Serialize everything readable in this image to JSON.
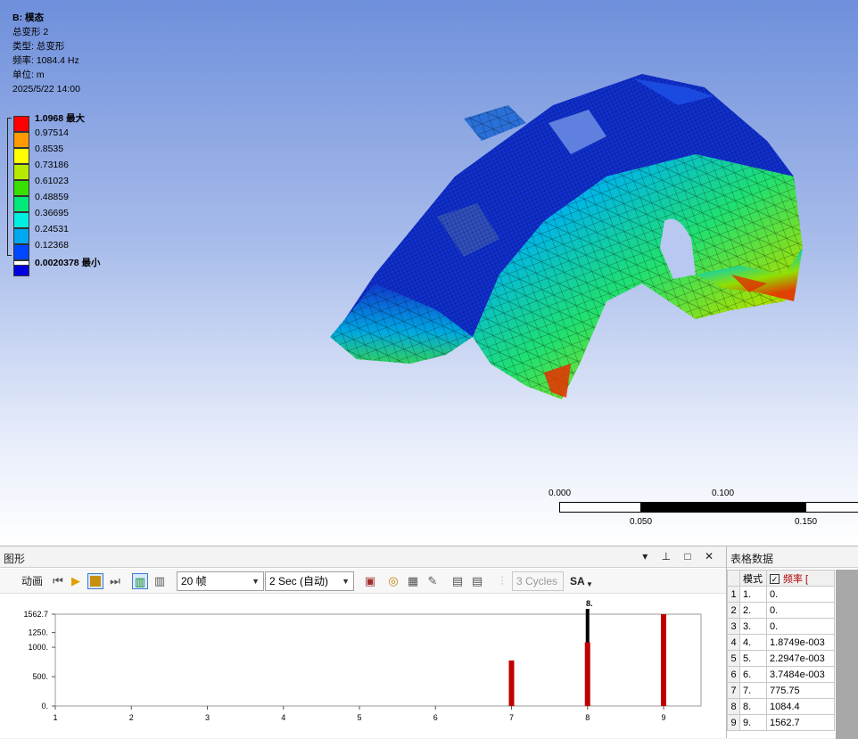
{
  "info": {
    "title": "B: 模态",
    "line1": "总变形 2",
    "line2": "类型: 总变形",
    "line3": "频率: 1084.4   Hz",
    "line4": "单位: m",
    "line5": "2025/5/22 14:00"
  },
  "legend": [
    {
      "label": "1.0968 最大",
      "color": "#ff0000",
      "bold": true
    },
    {
      "label": "0.97514",
      "color": "#ff9a00",
      "bold": false
    },
    {
      "label": "0.8535",
      "color": "#ffff00",
      "bold": false
    },
    {
      "label": "0.73186",
      "color": "#b8e800",
      "bold": false
    },
    {
      "label": "0.61023",
      "color": "#38e000",
      "bold": false
    },
    {
      "label": "0.48859",
      "color": "#00e87a",
      "bold": false
    },
    {
      "label": "0.36695",
      "color": "#00f0e0",
      "bold": false
    },
    {
      "label": "0.24531",
      "color": "#00a8f0",
      "bold": false
    },
    {
      "label": "0.12368",
      "color": "#0048ff",
      "bold": false
    },
    {
      "label": "0.0020378 最小",
      "color": "#0000e0",
      "bold": true
    }
  ],
  "scalebar": {
    "top_left": "0.000",
    "top_mid": "0.100",
    "bot_left": "0.050",
    "bot_right": "0.150"
  },
  "graph": {
    "title": "图形",
    "header_icons": "▾ ⊥ □ ✕",
    "toolbar": {
      "animate_label": "动画",
      "frames": "20 帧",
      "duration": "2 Sec (自动)",
      "cycles": "3 Cycles",
      "sa": "SA"
    }
  },
  "table": {
    "title": "表格数据",
    "col_mode": "模式",
    "col_freq": "频率 [",
    "check": "✓",
    "rows": [
      {
        "idx": "1",
        "mode": "1.",
        "freq": "0."
      },
      {
        "idx": "2",
        "mode": "2.",
        "freq": "0."
      },
      {
        "idx": "3",
        "mode": "3.",
        "freq": "0."
      },
      {
        "idx": "4",
        "mode": "4.",
        "freq": "1.8749e-003"
      },
      {
        "idx": "5",
        "mode": "5.",
        "freq": "2.2947e-003"
      },
      {
        "idx": "6",
        "mode": "6.",
        "freq": "3.7484e-003"
      },
      {
        "idx": "7",
        "mode": "7.",
        "freq": "775.75"
      },
      {
        "idx": "8",
        "mode": "8.",
        "freq": "1084.4"
      },
      {
        "idx": "9",
        "mode": "9.",
        "freq": "1562.7"
      }
    ]
  },
  "chart_data": {
    "type": "bar",
    "categories": [
      "1",
      "2",
      "3",
      "4",
      "5",
      "6",
      "7",
      "8",
      "9"
    ],
    "values": [
      0,
      0,
      0,
      0.0018749,
      0.0022947,
      0.0037484,
      775.75,
      1084.4,
      1562.7
    ],
    "yticks": [
      "0.",
      "500.",
      "1000.",
      "1250.",
      "1562.7"
    ],
    "ytick_values": [
      0,
      500,
      1000,
      1250,
      1562.7
    ],
    "ylim": [
      0,
      1562.7
    ],
    "selected_index": 7,
    "selected_label": "8.",
    "bar_color": "#c00000",
    "title": "",
    "xlabel": "",
    "ylabel": ""
  }
}
